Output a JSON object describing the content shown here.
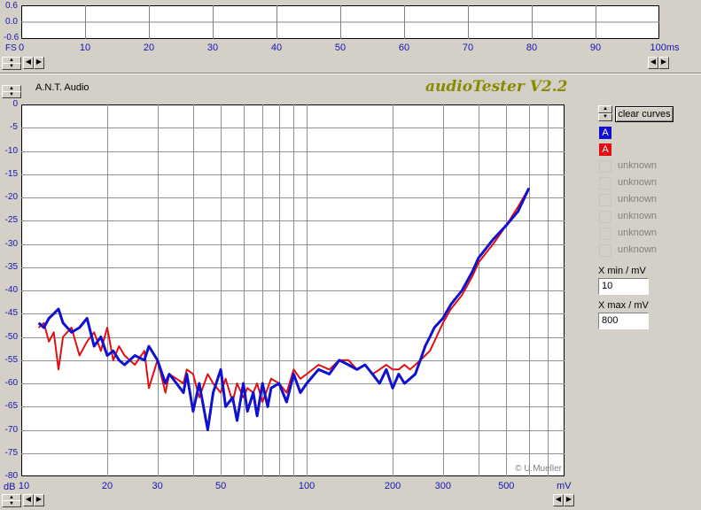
{
  "app": {
    "company": "A.N.T. Audio",
    "brand": "audioTester V2.2",
    "copyright": "© U.Mueller"
  },
  "top_chart": {
    "y_ticks": [
      "0.6",
      "0.0",
      "-0.6"
    ],
    "y_unit": "FS",
    "x_ticks": [
      "0",
      "10",
      "20",
      "30",
      "40",
      "50",
      "60",
      "70",
      "80",
      "90",
      "100ms"
    ]
  },
  "controls": {
    "clear_curves": "clear curves",
    "curve_a1": "A",
    "curve_a2": "A",
    "unknown_items": [
      "unknown",
      "unknown",
      "unknown",
      "unknown",
      "unknown",
      "unknown"
    ],
    "xmin_label": "X min / mV",
    "xmin_value": "10",
    "xmax_label": "X max / mV",
    "xmax_value": "800"
  },
  "colors": {
    "blue": "#1010d0",
    "red": "#e01010",
    "brand": "#8a8a00",
    "axis_text": "#1515b0"
  },
  "chart_data": {
    "type": "line",
    "x_scale": "log",
    "xlim": [
      10,
      800
    ],
    "ylim": [
      -80,
      0
    ],
    "y_ticks": [
      "0",
      "-5",
      "-10",
      "-15",
      "-20",
      "-25",
      "-30",
      "-35",
      "-40",
      "-45",
      "-50",
      "-55",
      "-60",
      "-65",
      "-70",
      "-75",
      "-80"
    ],
    "y_unit": "dB",
    "x_ticks": [
      "10",
      "20",
      "30",
      "50",
      "100",
      "200",
      "300",
      "500"
    ],
    "x_unit": "mV",
    "series": [
      {
        "color": "#1010d0",
        "x": [
          11.5,
          12,
          12.5,
          13,
          13.5,
          14,
          15,
          16,
          17,
          18,
          19,
          20,
          21,
          22,
          23,
          25,
          27,
          28,
          30,
          32,
          33,
          35,
          37,
          38,
          40,
          42,
          45,
          47,
          50,
          52,
          55,
          57,
          60,
          62,
          65,
          67,
          70,
          73,
          75,
          80,
          85,
          90,
          95,
          100,
          110,
          120,
          130,
          140,
          150,
          160,
          170,
          180,
          190,
          200,
          210,
          220,
          230,
          240,
          250,
          260,
          270,
          280,
          300,
          320,
          350,
          380,
          400,
          450,
          500,
          550,
          600
        ],
        "y": [
          -47,
          -48,
          -46,
          -45,
          -44,
          -47,
          -49,
          -48,
          -46,
          -52,
          -50,
          -54,
          -53,
          -55,
          -56,
          -54,
          -55,
          -52,
          -55,
          -60,
          -58,
          -60,
          -62,
          -58,
          -66,
          -60,
          -70,
          -62,
          -57,
          -65,
          -63,
          -68,
          -60,
          -66,
          -62,
          -67,
          -60,
          -65,
          -61,
          -60,
          -64,
          -58,
          -62,
          -60,
          -57,
          -58,
          -55,
          -56,
          -57,
          -56,
          -58,
          -60,
          -57,
          -61,
          -58,
          -60,
          -59,
          -58,
          -55,
          -52,
          -50,
          -48,
          -46,
          -43,
          -40,
          -36,
          -33,
          -29,
          -26,
          -23,
          -18
        ]
      },
      {
        "color": "#e01010",
        "x": [
          11.5,
          12,
          12.5,
          13,
          13.5,
          14,
          15,
          16,
          17,
          18,
          19,
          20,
          21,
          22,
          23,
          25,
          27,
          28,
          30,
          32,
          33,
          35,
          37,
          38,
          40,
          42,
          45,
          47,
          50,
          52,
          55,
          57,
          60,
          62,
          65,
          67,
          70,
          73,
          75,
          80,
          85,
          90,
          95,
          100,
          110,
          120,
          130,
          140,
          150,
          160,
          170,
          180,
          190,
          200,
          210,
          220,
          230,
          240,
          250,
          260,
          270,
          280,
          300,
          320,
          350,
          380,
          400,
          450,
          500,
          550,
          600
        ],
        "y": [
          -48,
          -47,
          -51,
          -49,
          -57,
          -50,
          -48,
          -54,
          -51,
          -49,
          -53,
          -48,
          -55,
          -52,
          -54,
          -56,
          -53,
          -61,
          -55,
          -62,
          -58,
          -59,
          -60,
          -57,
          -58,
          -63,
          -58,
          -60,
          -62,
          -59,
          -64,
          -60,
          -63,
          -61,
          -62,
          -60,
          -64,
          -61,
          -59,
          -60,
          -62,
          -57,
          -59,
          -58,
          -56,
          -57,
          -55,
          -55,
          -57,
          -56,
          -58,
          -57,
          -56,
          -57,
          -57,
          -56,
          -57,
          -56,
          -55,
          -54,
          -53,
          -51,
          -47,
          -44,
          -41,
          -37,
          -34,
          -30,
          -26,
          -22,
          -18
        ]
      }
    ]
  }
}
